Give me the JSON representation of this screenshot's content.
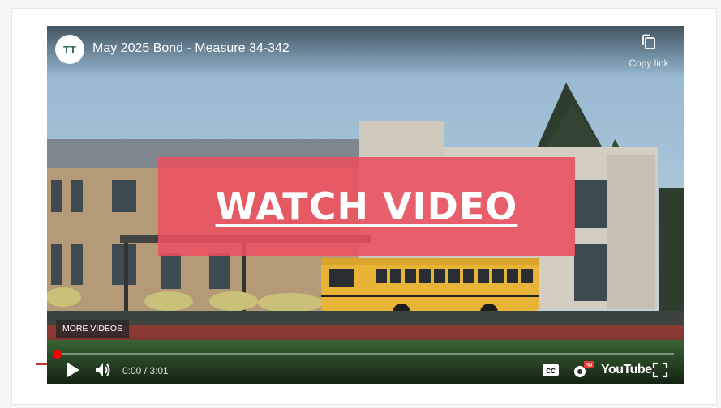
{
  "video": {
    "title": "May 2025 Bond - Measure 34-342",
    "channel_logo_text": "TT",
    "copy_link_label": "Copy link",
    "overlay_text": "WATCH VIDEO",
    "more_videos_label": "MORE VIDEOS",
    "time": "0:00 / 3:01",
    "progress": 0.0,
    "youtube_label": "YouTube",
    "hd_badge": "HD",
    "cc_label": "CC",
    "colors": {
      "overlay": "#eb505f",
      "progress": "#ff0000",
      "accent": "#2c6b4d"
    },
    "icons": [
      "copy-icon",
      "play-icon",
      "volume-icon",
      "cc-icon",
      "settings-icon",
      "fullscreen-icon"
    ]
  }
}
